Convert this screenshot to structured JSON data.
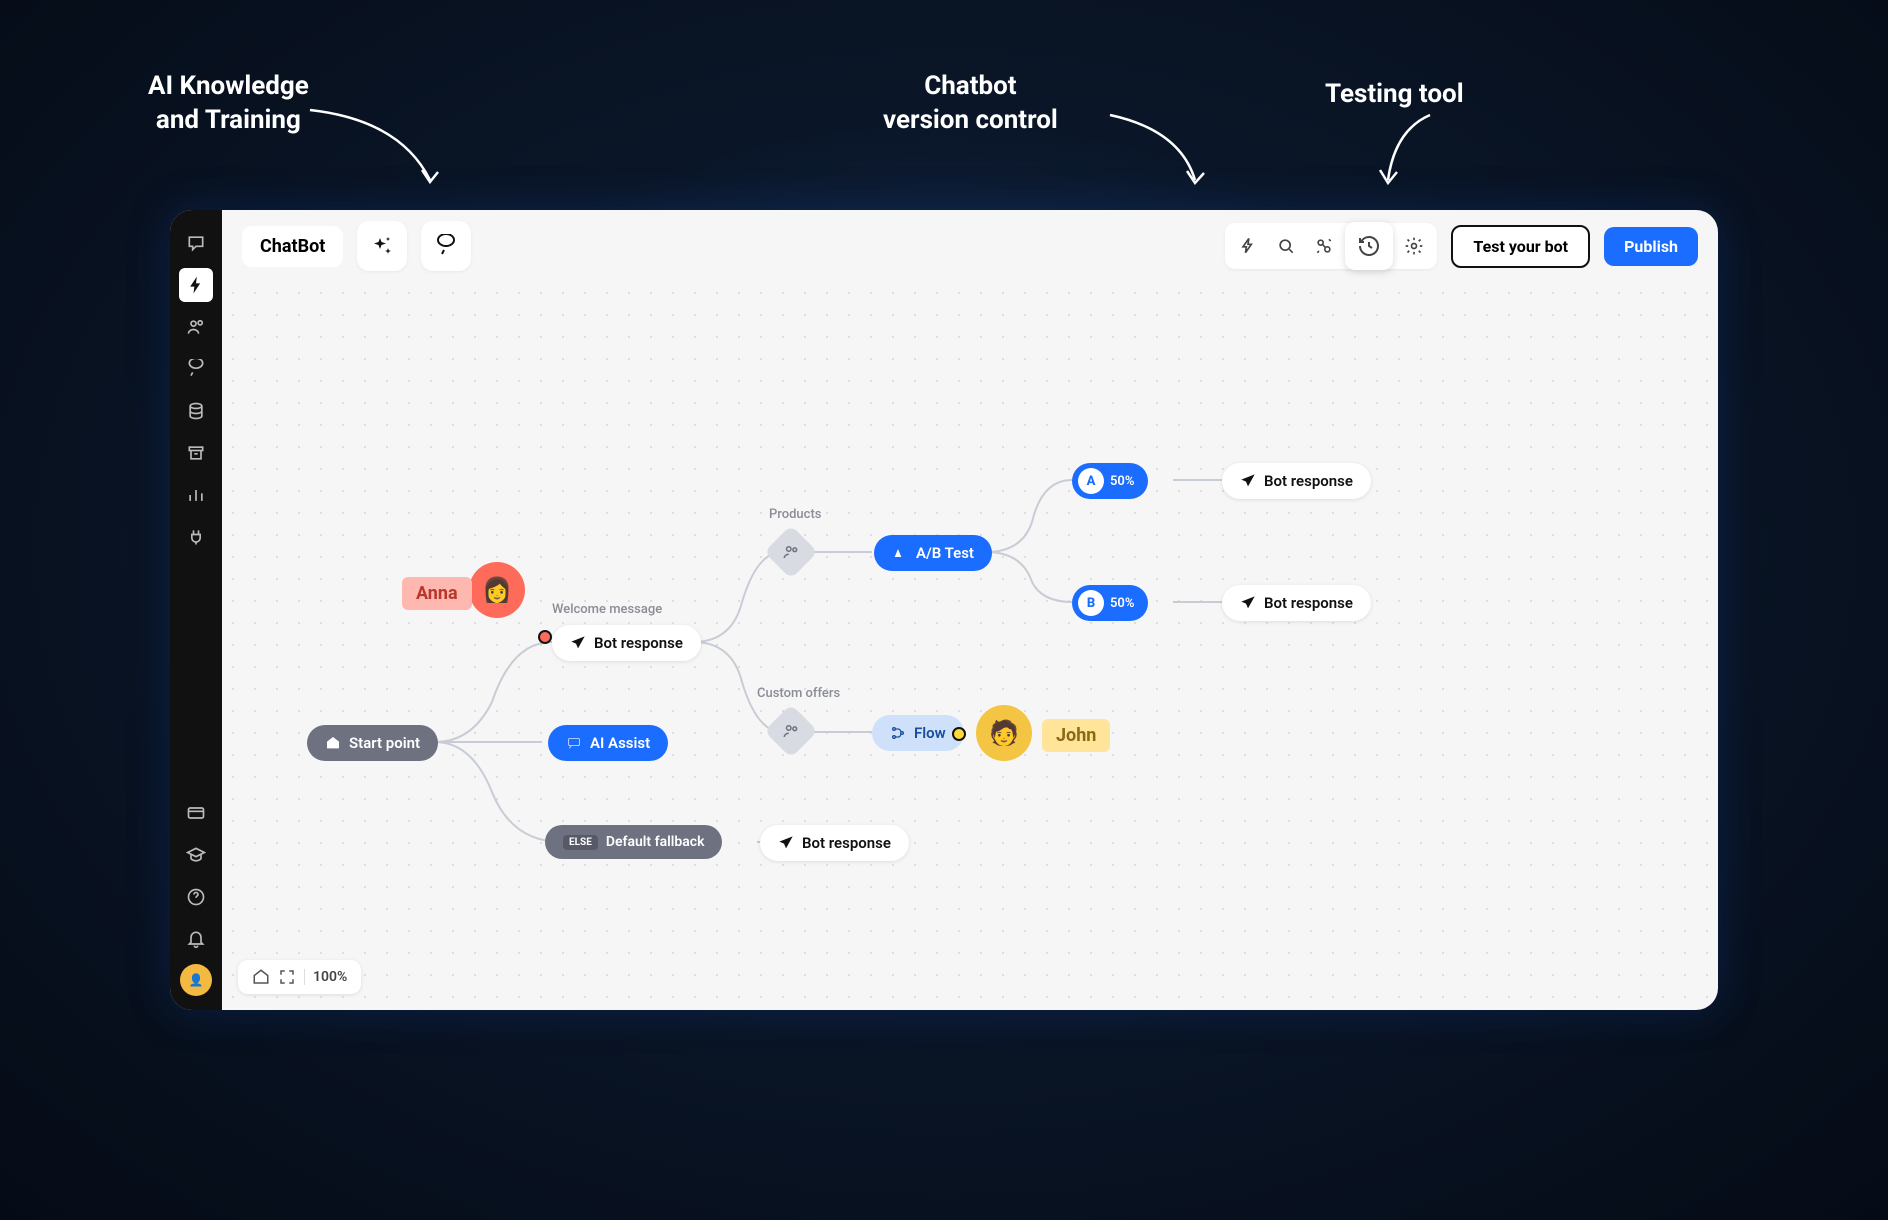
{
  "callouts": {
    "c1": "AI Knowledge\nand Training",
    "c2": "Chatbot\nversion control",
    "c3": "Testing tool"
  },
  "toolbar": {
    "title": "ChatBot",
    "test": "Test your bot",
    "publish": "Publish"
  },
  "zoom": {
    "level": "100%"
  },
  "nodes": {
    "start": "Start point",
    "ai_assist": "AI Assist",
    "welcome_label": "Welcome message",
    "welcome": "Bot response",
    "products_label": "Products",
    "custom_label": "Custom offers",
    "abtest": "A/B Test",
    "a_badge": "A",
    "a_pct": "50%",
    "b_badge": "B",
    "b_pct": "50%",
    "br_a": "Bot response",
    "br_b": "Bot response",
    "flow": "Flow",
    "else_tag": "ELSE",
    "fallback": "Default fallback",
    "br_fb": "Bot response"
  },
  "users": {
    "anna": "Anna",
    "john": "John"
  }
}
